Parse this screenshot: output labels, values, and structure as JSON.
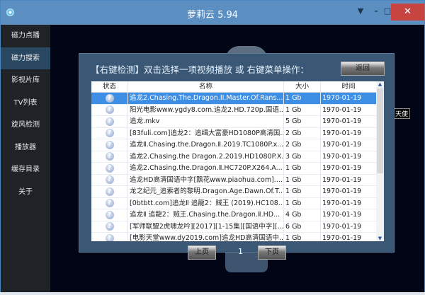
{
  "window": {
    "title": "萝莉云 5.94",
    "controls": {
      "menu": "▼",
      "minimize": "–",
      "maximize": "□",
      "close": "✕"
    }
  },
  "sidebar": {
    "items": [
      {
        "label": "磁力点播"
      },
      {
        "label": "磁力搜索",
        "active": true
      },
      {
        "label": "影视片库"
      },
      {
        "label": "TV列表"
      },
      {
        "label": "旋风检测"
      },
      {
        "label": "播放器"
      },
      {
        "label": "缓存目录"
      },
      {
        "label": "关于"
      }
    ]
  },
  "background_tag": "天使",
  "dialog": {
    "title": "【右键检测】双击选择一项视频播放 或 右键菜单操作：",
    "back_label": "返回",
    "columns": [
      "状态",
      "名称",
      "大小",
      "时间"
    ],
    "status_icon": "question-icon",
    "rows": [
      {
        "name": "追龙2.Chasing.The.Dragon.II.Master.Of.Rans...",
        "size": "1 Gb",
        "time": "1970-01-19"
      },
      {
        "name": "阳光电影www.ygdy8.com.追龙2.HD.720p.国语...",
        "size": "1 Gb",
        "time": "1970-01-19"
      },
      {
        "name": "追龙.mkv",
        "size": "5 Gb",
        "time": "1970-01-19"
      },
      {
        "name": "[83fuli.com]追龙2：追缉大富豪HD1080P高清国...",
        "size": "2 Gb",
        "time": "1970-01-19"
      },
      {
        "name": "追龙Ⅱ.Chasing.the.Dragon.Ⅱ.2019.TC1080P.x...",
        "size": "2 Gb",
        "time": "1970-01-19"
      },
      {
        "name": "追龙2.Chasing.the Dragon.2.2019.HD1080P.X...",
        "size": "3 Gb",
        "time": "1970-01-19"
      },
      {
        "name": "追龙2.Chasing.the.Dragon.Ⅱ.HC720P.X264.A...",
        "size": "1 Gb",
        "time": "1970-01-19"
      },
      {
        "name": "追龙HD高清国语中字[飘花www.piaohua.com]....",
        "size": "1 Gb",
        "time": "1970-01-19"
      },
      {
        "name": "龙之纪元_追索者的黎明.Dragon.Age.Dawn.Of.T...",
        "size": "1 Gb",
        "time": "1970-01-19"
      },
      {
        "name": "[0btbtt.com]追龙Ⅱ 追龍2：贼王 (2019).HC108...",
        "size": "1 Gb",
        "time": "1970-01-19"
      },
      {
        "name": "追龙Ⅱ 追龍2：贼王.Chasing.the.Dragon.Ⅱ.HD...",
        "size": "4 Gb",
        "time": "1970-01-19"
      },
      {
        "name": "[军师联盟2虎啸龙吟][2017][1-15集][国语中字][...",
        "size": "6 Gb",
        "time": "1970-01-19"
      },
      {
        "name": "[电影天堂www.dy2019.com]追龙HD高清国语中...",
        "size": "1 Gb",
        "time": "1970-01-19"
      }
    ],
    "prev_label": "上页",
    "next_label": "下页",
    "page": "1"
  }
}
